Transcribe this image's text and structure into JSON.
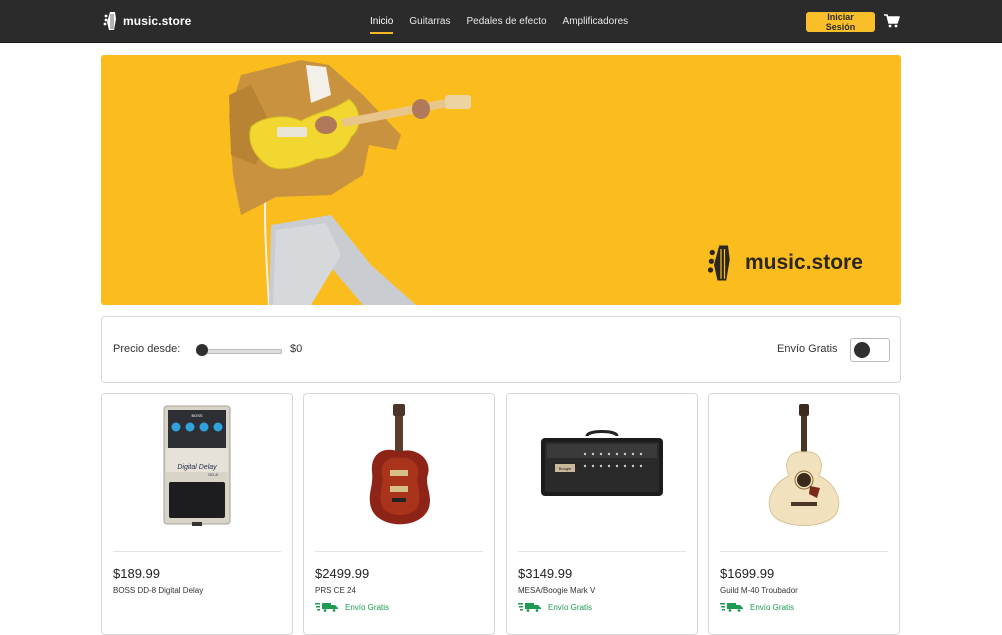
{
  "brand": {
    "name": "music.store"
  },
  "nav": {
    "items": [
      {
        "label": "Inicio",
        "active": true
      },
      {
        "label": "Guitarras",
        "active": false
      },
      {
        "label": "Pedales de efecto",
        "active": false
      },
      {
        "label": "Amplificadores",
        "active": false
      }
    ],
    "login_label": "Iniciar Sesión"
  },
  "hero": {
    "brand_name": "music.store"
  },
  "filters": {
    "price_label": "Precio desde:",
    "price_value": "$0",
    "price_fraction": 0,
    "free_shipping_label": "Envío Gratis",
    "free_shipping_on": false
  },
  "products": [
    {
      "price": "$189.99",
      "title": "BOSS DD-8 Digital Delay",
      "free_shipping": false,
      "image": "delay-pedal"
    },
    {
      "price": "$2499.99",
      "title": "PRS CE 24",
      "free_shipping": true,
      "shipping_label": "Envío Gratis",
      "image": "electric-guitar"
    },
    {
      "price": "$3149.99",
      "title": "MESA/Boogie Mark V",
      "free_shipping": true,
      "shipping_label": "Envío Gratis",
      "image": "amp-head"
    },
    {
      "price": "$1699.99",
      "title": "Guild M-40 Troubador",
      "free_shipping": true,
      "shipping_label": "Envío Gratis",
      "image": "acoustic-guitar"
    }
  ],
  "pedal_labels": {
    "brand": "BOSS",
    "model": "Digital Delay",
    "code": "DD-8"
  },
  "amp_labels": {
    "badge": "Boogie"
  },
  "colors": {
    "accent": "#f8bf2a",
    "navbar": "#2b2b2b",
    "hero_bg": "#fbbd1d",
    "shipping_green": "#1e9a52"
  }
}
